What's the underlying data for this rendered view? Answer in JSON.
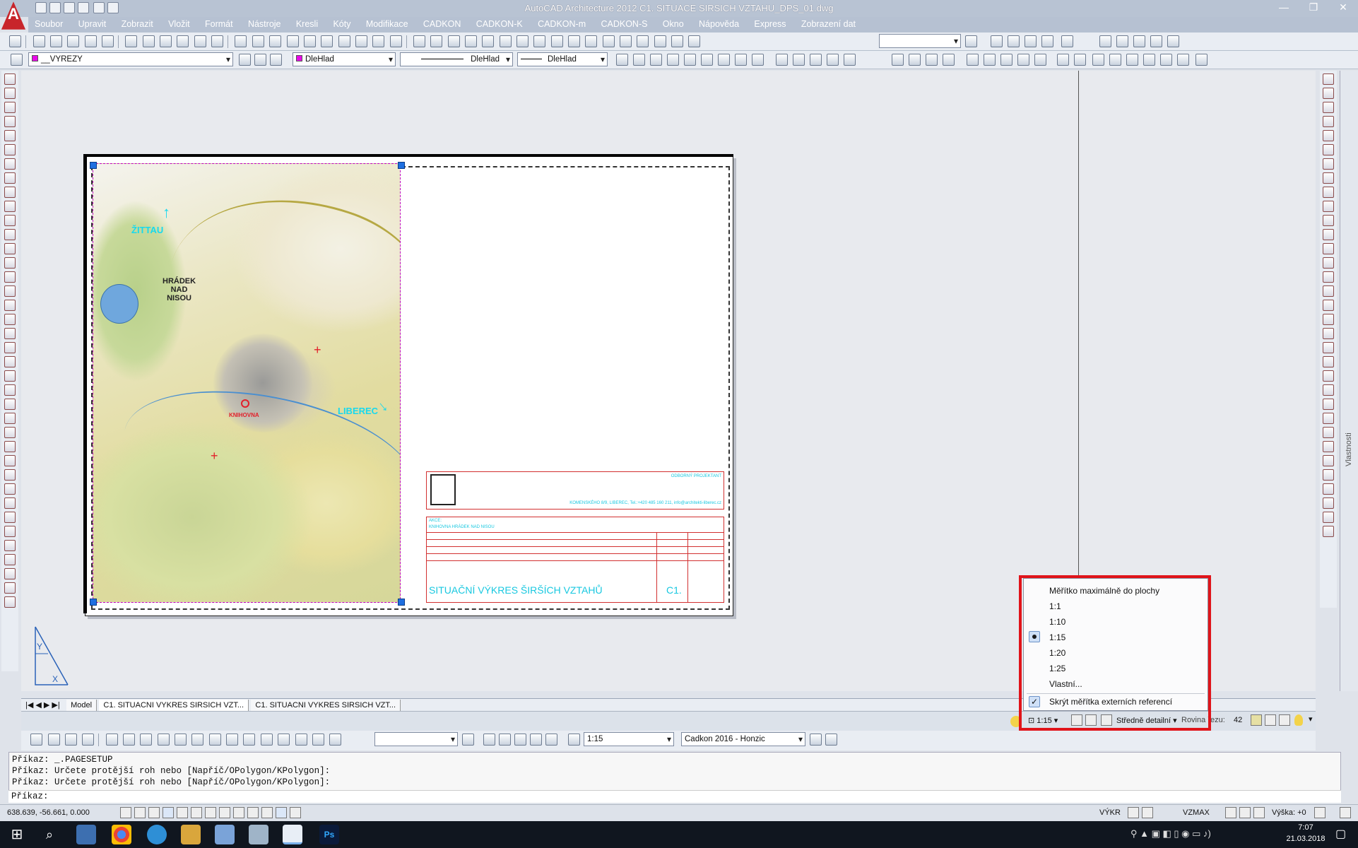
{
  "window": {
    "title": "AutoCAD Architecture 2012    C1. SITUACE SIRSICH VZTAHU_DPS_01.dwg"
  },
  "menu": [
    "Soubor",
    "Upravit",
    "Zobrazit",
    "Vložit",
    "Formát",
    "Nástroje",
    "Kresli",
    "Kóty",
    "Modifikace",
    "CADKON",
    "CADKON-K",
    "CADKON-m",
    "CADKON-S",
    "Okno",
    "Nápověda",
    "Express",
    "Zobrazení dat"
  ],
  "toolbar2": {
    "layer_value": "__VYREZY",
    "color_value": "DleHlad",
    "linetype_value": "DleHlad",
    "lineweight_value": "DleHlad"
  },
  "drawing": {
    "map_labels": {
      "zittau": "ŽITTAU",
      "hradek": "HRÁDEK\nNAD\nNISOU",
      "liberec": "LIBEREC",
      "knihovna": "KNIHOVNA"
    },
    "titleblock": {
      "company": "ODBORNÝ PROJEKTANT",
      "address": "KOMENSKÉHO 8/9, LIBEREC,  Tel.:+420 485 160 211,  info@architekti-liberec.cz",
      "stavba_label": "AKCE:",
      "stavba": "KNIHOVNA HRÁDEK NAD NISOU",
      "title": "SITUAČNÍ VÝKRES ŠIRŠÍCH VZTAHŮ",
      "code": "C1."
    }
  },
  "tabs": {
    "model": "Model",
    "layout1": "C1. SITUACNI VYKRES SIRSICH VZT...",
    "layout2": "C1. SITUACNI VYKRES SIRSICH VZT..."
  },
  "scale_menu": {
    "items": [
      {
        "label": "Měřítko maximálně do plochy",
        "selected": false
      },
      {
        "label": "1:1",
        "selected": false
      },
      {
        "label": "1:10",
        "selected": false
      },
      {
        "label": "1:15",
        "selected": true
      },
      {
        "label": "1:20",
        "selected": false
      },
      {
        "label": "1:25",
        "selected": false
      },
      {
        "label": "Vlastní...",
        "selected": false
      }
    ],
    "hide_xref_scales": "Skrýt měřítka externích referencí",
    "hide_xref_checked": true
  },
  "status_row": {
    "scale": "1:15",
    "detail": "Středně detailní",
    "cut_plane": "Rovina řezu:",
    "cut_value": "42"
  },
  "bottom_toolbar": {
    "scale": "1:15",
    "style": "Cadkon 2016 - Honzic"
  },
  "command": {
    "lines": [
      "Příkaz:  _.PAGESETUP",
      "Příkaz: Určete protější roh nebo [Napříč/OPolygon/KPolygon]:",
      "Příkaz: Určete protější roh nebo [Napříč/OPolygon/KPolygon]:"
    ],
    "prompt": "Příkaz:"
  },
  "app_status": {
    "coords": "638.639, -56.661, 0.000",
    "vykr": "VÝKR",
    "vzmax": "VZMAX",
    "vyska": "Výška: +0"
  },
  "right_panel": {
    "properties_label": "Vlastnosti"
  },
  "taskbar": {
    "time": "7:07",
    "date": "21.03.2018"
  }
}
